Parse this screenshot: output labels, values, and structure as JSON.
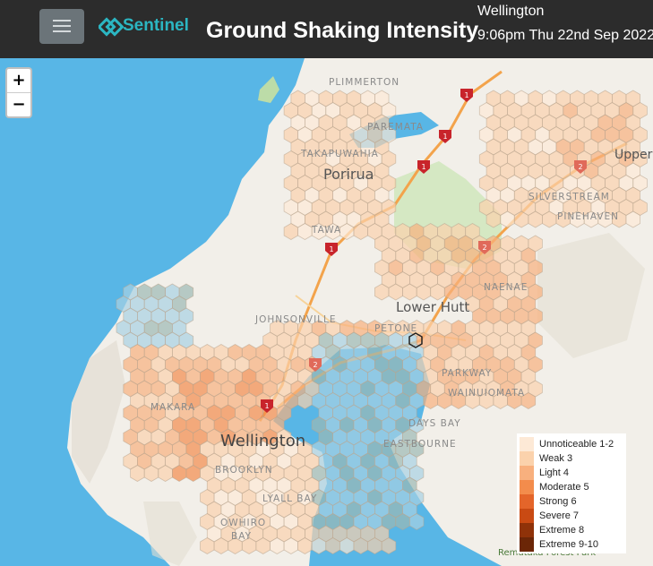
{
  "header": {
    "menu_icon": "hamburger-icon",
    "brand": "Sentinel",
    "brand_color": "#2bb6c2",
    "title": "Ground Shaking Intensity",
    "location": "Wellington",
    "datetime": "9:06pm Thu 22nd Sep 2022"
  },
  "zoom": {
    "in_label": "+",
    "out_label": "−"
  },
  "places": {
    "plimmerton": "PLIMMERTON",
    "paremata": "PAREMATA",
    "takapuwahia": "TAKAPUWAHIA",
    "porirua": "Porirua",
    "tawa": "TAWA",
    "upper": "Upper",
    "silverstream": "SILVERSTREAM",
    "pinehaven": "PINEHAVEN",
    "naenae": "NAENAE",
    "johnsonville": "JOHNSONVILLE",
    "lower_hutt": "Lower Hutt",
    "petone": "PETONE",
    "parkway": "PARKWAY",
    "wainuiomata": "WAINUIOMATA",
    "makara": "MAKARA",
    "days_bay": "DAYS BAY",
    "wellington": "Wellington",
    "eastbourne": "EASTBOURNE",
    "brooklyn": "BROOKLYN",
    "lyall_bay": "LYALL BAY",
    "owhiro": "OWHIRO",
    "bay": "BAY",
    "forest_park": "Remutaka Forest Park"
  },
  "road_shield": "1",
  "road_shield2": "2",
  "legend": [
    {
      "label": "Unnoticeable 1-2",
      "color": "#fde9d6"
    },
    {
      "label": "Weak 3",
      "color": "#fbd2ac"
    },
    {
      "label": "Light 4",
      "color": "#f8b07e"
    },
    {
      "label": "Moderate 5",
      "color": "#f38c4c"
    },
    {
      "label": "Strong 6",
      "color": "#e4652a"
    },
    {
      "label": "Severe 7",
      "color": "#c94a13"
    },
    {
      "label": "Extreme 8",
      "color": "#8f3209"
    },
    {
      "label": "Extreme 9-10",
      "color": "#6b2607"
    }
  ]
}
